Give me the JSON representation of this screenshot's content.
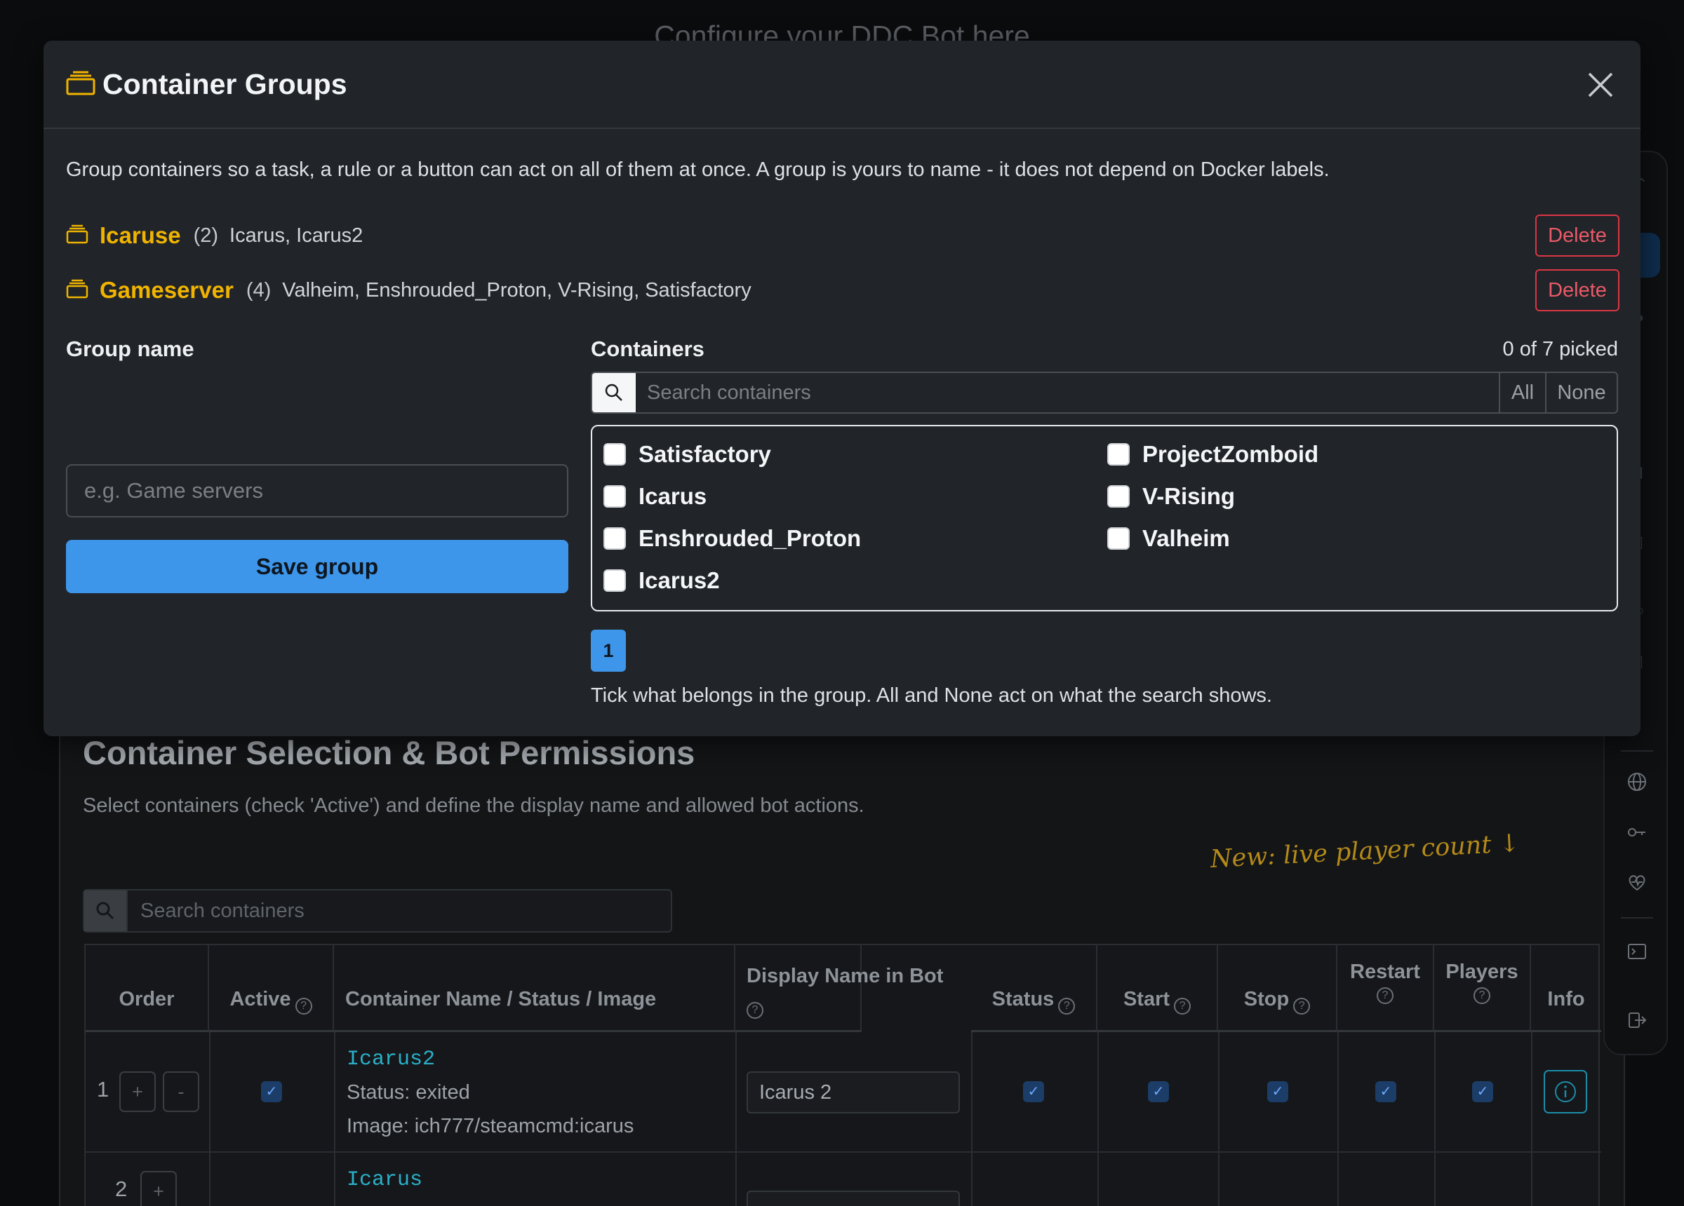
{
  "background": {
    "header_text": "Configure your DDC Bot here",
    "section_title": "Container Selection & Bot Permissions",
    "section_desc": "Select containers (check 'Active') and define the display name and allowed bot actions.",
    "annotation": "New: live player count ↓",
    "search_placeholder": "Search containers",
    "table": {
      "headers": {
        "order": "Order",
        "active": "Active",
        "name": "Container Name / Status / Image",
        "display": "Display Name in Bot",
        "status": "Status",
        "start": "Start",
        "stop": "Stop",
        "restart": "Restart",
        "players": "Players",
        "info": "Info"
      },
      "help_mark": "?",
      "rows": [
        {
          "order": "1",
          "name": "Icarus2",
          "status": "Status: exited",
          "image": "Image: ich777/steamcmd:icarus",
          "display": "Icarus 2"
        },
        {
          "order": "2",
          "name": "Icarus",
          "status": "",
          "image": "",
          "display": ""
        }
      ],
      "plus": "+",
      "minus": "-"
    }
  },
  "modal": {
    "title": "Container Groups",
    "intro": "Group containers so a task, a rule or a button can act on all of them at once. A group is yours to name - it does not depend on Docker labels.",
    "groups": [
      {
        "name": "Icaruse",
        "count": "(2)",
        "members": "Icarus, Icarus2",
        "delete_label": "Delete"
      },
      {
        "name": "Gameserver",
        "count": "(4)",
        "members": "Valheim, Enshrouded_Proton, V-Rising, Satisfactory",
        "delete_label": "Delete"
      }
    ],
    "group_name_label": "Group name",
    "group_name_placeholder": "e.g. Game servers",
    "save_label": "Save group",
    "containers_label": "Containers",
    "picked": "0 of 7 picked",
    "search_placeholder": "Search containers",
    "all_label": "All",
    "none_label": "None",
    "containers": [
      {
        "name": "Satisfactory",
        "checked": false
      },
      {
        "name": "Icarus",
        "checked": false
      },
      {
        "name": "Enshrouded_Proton",
        "checked": false
      },
      {
        "name": "Icarus2",
        "checked": false
      },
      {
        "name": "ProjectZomboid",
        "checked": false
      },
      {
        "name": "V-Rising",
        "checked": false
      },
      {
        "name": "Valheim",
        "checked": false
      }
    ],
    "page": "1",
    "hint": "Tick what belongs in the group. All and None act on what the search shows."
  },
  "colors": {
    "accent": "#3d96ea",
    "group_name": "#f0b400",
    "danger": "#dc3545"
  }
}
